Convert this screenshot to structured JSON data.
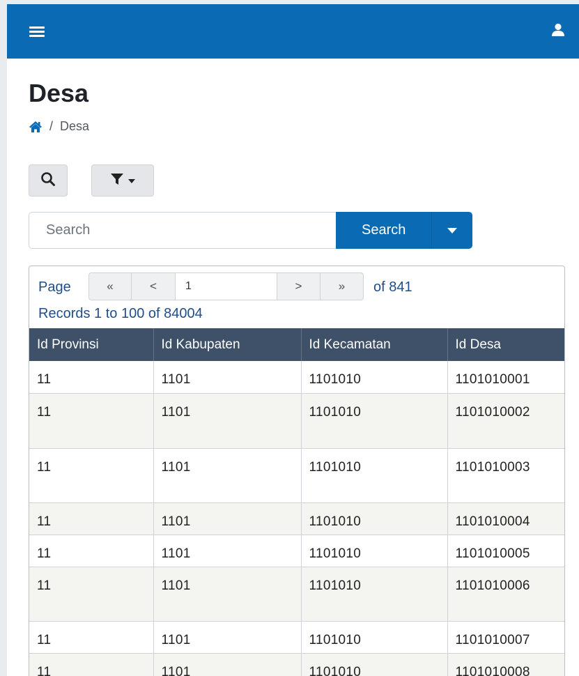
{
  "page": {
    "title": "Desa"
  },
  "breadcrumb": {
    "separator": "/",
    "current": "Desa"
  },
  "search": {
    "placeholder": "Search",
    "button_label": "Search"
  },
  "pager": {
    "label": "Page",
    "first": "«",
    "prev": "<",
    "current_page": "1",
    "next": ">",
    "last": "»",
    "of_text": "of 841",
    "records_text": "Records 1 to 100 of 84004"
  },
  "table": {
    "columns": [
      "Id Provinsi",
      "Id Kabupaten",
      "Id Kecamatan",
      "Id Desa"
    ],
    "rows": [
      [
        "11",
        "1101",
        "1101010",
        "1101010001"
      ],
      [
        "11",
        "1101",
        "1101010",
        "1101010002"
      ],
      [
        "11",
        "1101",
        "1101010",
        "1101010003"
      ],
      [
        "11",
        "1101",
        "1101010",
        "1101010004"
      ],
      [
        "11",
        "1101",
        "1101010",
        "1101010005"
      ],
      [
        "11",
        "1101",
        "1101010",
        "1101010006"
      ],
      [
        "11",
        "1101",
        "1101010",
        "1101010007"
      ],
      [
        "11",
        "1101",
        "1101010",
        "1101010008"
      ]
    ]
  },
  "icons": {
    "menu": "hamburger-menu-icon",
    "user": "user-icon",
    "home": "home-icon",
    "search": "search-icon",
    "filter": "filter-icon",
    "caret": "caret-down-icon"
  },
  "colors": {
    "navbar": "#0a6ab3",
    "primary_button": "#0a6ab3",
    "table_header": "#3e5168",
    "link_text": "#1f4e8a"
  }
}
